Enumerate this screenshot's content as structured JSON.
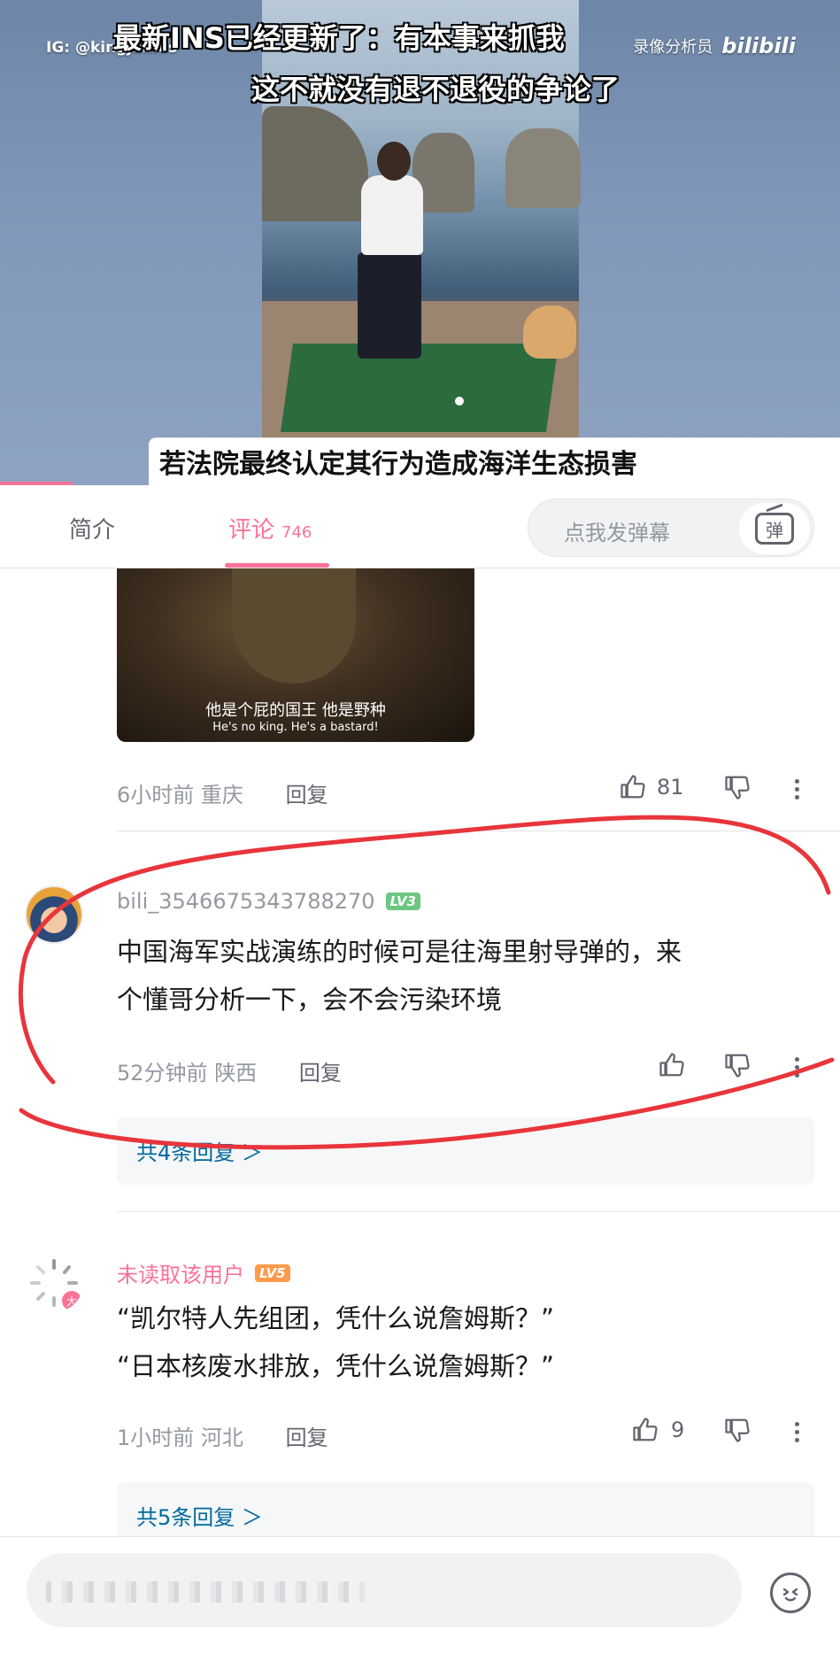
{
  "video": {
    "watermark_ig": "IG: @kingjames",
    "watermark_recorder": "录像分析员",
    "watermark_logo": "bilibili",
    "caption_line1": "最新INS已经更新了：有本事来抓我",
    "caption_line2": "这不就没有退不退役的争论了",
    "caption_bottom": "若法院最终认定其行为造成海洋生态损害"
  },
  "tabs": {
    "intro": "简介",
    "comments": "评论",
    "comment_count": "746",
    "danmaku_placeholder": "点我发弹幕",
    "danmaku_button": "弹"
  },
  "comments": [
    {
      "image_subtitle_cn": "他是个屁的国王 他是野种",
      "image_subtitle_en": "He's no king. He's a bastard!",
      "time": "6小时前",
      "location": "重庆",
      "reply_label": "回复",
      "likes": "81"
    },
    {
      "username": "bili_3546675343788270",
      "level": "LV3",
      "text_line1": "中国海军实战演练的时候可是往海里射导弹的，来",
      "text_line2": "个懂哥分析一下，会不会污染环境",
      "time": "52分钟前",
      "location": "陕西",
      "reply_label": "回复",
      "replies_link": "共4条回复 ＞"
    },
    {
      "username": "未读取该用户",
      "level": "LV5",
      "avatar_badge": "大",
      "text_line1": "“凯尔特人先组团，凭什么说詹姆斯？”",
      "text_line2": "“日本核废水排放，凭什么说詹姆斯？”",
      "time": "1小时前",
      "location": "河北",
      "reply_label": "回复",
      "likes": "9",
      "replies_link": "共5条回复 ＞"
    }
  ],
  "annotation_color": "#e8353b",
  "accent_color": "#fb7299",
  "icons": [
    "like-icon",
    "dislike-icon",
    "more-icon",
    "danmaku-tv-icon",
    "emoji-icon"
  ]
}
